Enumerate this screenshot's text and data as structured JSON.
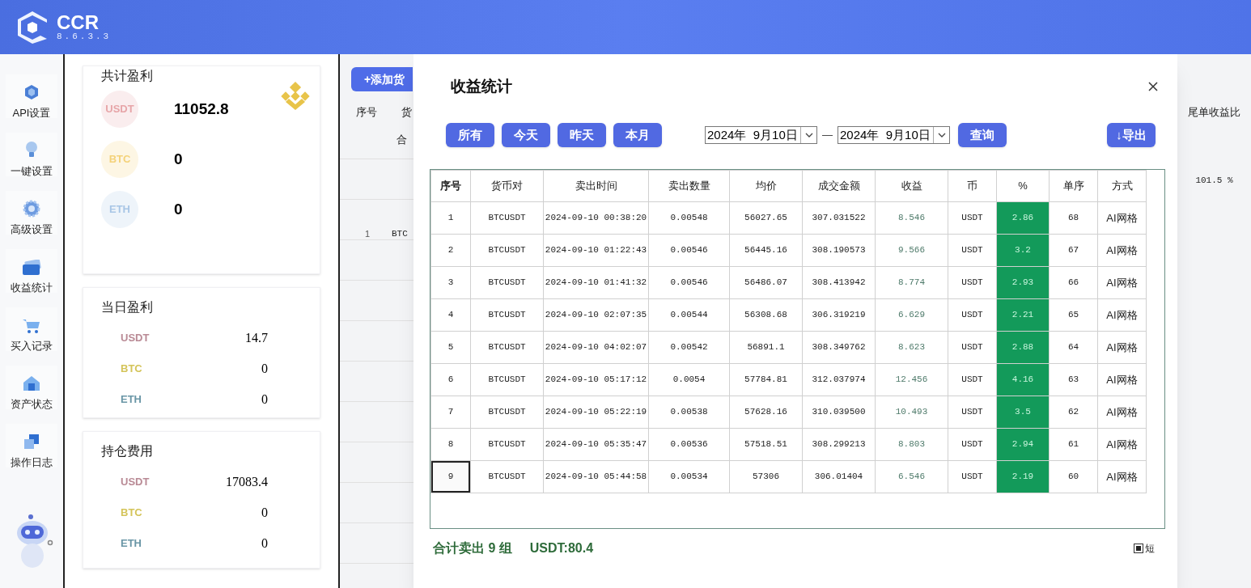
{
  "app": {
    "name": "CCR",
    "version": "8.6.3.3"
  },
  "sidebar": {
    "items": [
      {
        "label": "API设置"
      },
      {
        "label": "一键设置"
      },
      {
        "label": "高级设置"
      },
      {
        "label": "收益统计"
      },
      {
        "label": "买入记录"
      },
      {
        "label": "资产状态"
      },
      {
        "label": "操作日志"
      }
    ]
  },
  "summary": {
    "total": {
      "title": "共计盈利",
      "rows": [
        {
          "coin": "USDT",
          "value": "11052.8",
          "color": "#e7a5a8"
        },
        {
          "coin": "BTC",
          "value": "0",
          "color": "#f4d27a"
        },
        {
          "coin": "ETH",
          "value": "0",
          "color": "#a9c6e6"
        }
      ]
    },
    "today": {
      "title": "当日盈利",
      "rows": [
        {
          "coin": "USDT",
          "value": "14.7",
          "color": "#b98a95"
        },
        {
          "coin": "BTC",
          "value": "0",
          "color": "#d4c45a"
        },
        {
          "coin": "ETH",
          "value": "0",
          "color": "#6a96a6"
        }
      ]
    },
    "holding": {
      "title": "持仓费用",
      "rows": [
        {
          "coin": "USDT",
          "value": "17083.4",
          "color": "#b98a95"
        },
        {
          "coin": "BTC",
          "value": "0",
          "color": "#d4c45a"
        },
        {
          "coin": "ETH",
          "value": "0",
          "color": "#6a96a6"
        }
      ]
    }
  },
  "background_table": {
    "add_button": "+添加货",
    "columns": [
      "序号",
      "货"
    ],
    "cell_partial": "合",
    "row": [
      "1",
      "BTC"
    ],
    "right_column": "尾单收益比",
    "right_value": "101.5 %"
  },
  "dialog": {
    "title": "收益统计",
    "filters": [
      {
        "label": "所有"
      },
      {
        "label": "今天"
      },
      {
        "label": "昨天"
      },
      {
        "label": "本月"
      }
    ],
    "date_from": "2024年  9月10日",
    "date_separator": "—",
    "date_to": "2024年  9月10日",
    "query_button": "查询",
    "export_button": "↓导出",
    "columns": [
      "序号",
      "货币对",
      "卖出时间",
      "卖出数量",
      "均价",
      "成交金额",
      "收益",
      "币",
      "%",
      "单序",
      "方式"
    ],
    "rows": [
      {
        "cells": [
          "1",
          "BTCUSDT",
          "2024-09-10 00:38:20",
          "0.00548",
          "56027.65",
          "307.031522",
          "8.546",
          "USDT",
          "2.86",
          "68",
          "AI网格"
        ],
        "selected": false
      },
      {
        "cells": [
          "2",
          "BTCUSDT",
          "2024-09-10 01:22:43",
          "0.00546",
          "56445.16",
          "308.190573",
          "9.566",
          "USDT",
          "3.2",
          "67",
          "AI网格"
        ],
        "selected": false
      },
      {
        "cells": [
          "3",
          "BTCUSDT",
          "2024-09-10 01:41:32",
          "0.00546",
          "56486.07",
          "308.413942",
          "8.774",
          "USDT",
          "2.93",
          "66",
          "AI网格"
        ],
        "selected": false
      },
      {
        "cells": [
          "4",
          "BTCUSDT",
          "2024-09-10 02:07:35",
          "0.00544",
          "56308.68",
          "306.319219",
          "6.629",
          "USDT",
          "2.21",
          "65",
          "AI网格"
        ],
        "selected": false
      },
      {
        "cells": [
          "5",
          "BTCUSDT",
          "2024-09-10 04:02:07",
          "0.00542",
          "56891.1",
          "308.349762",
          "8.623",
          "USDT",
          "2.88",
          "64",
          "AI网格"
        ],
        "selected": false
      },
      {
        "cells": [
          "6",
          "BTCUSDT",
          "2024-09-10 05:17:12",
          "0.0054",
          "57784.81",
          "312.037974",
          "12.456",
          "USDT",
          "4.16",
          "63",
          "AI网格"
        ],
        "selected": false
      },
      {
        "cells": [
          "7",
          "BTCUSDT",
          "2024-09-10 05:22:19",
          "0.00538",
          "57628.16",
          "310.039500",
          "10.493",
          "USDT",
          "3.5",
          "62",
          "AI网格"
        ],
        "selected": false
      },
      {
        "cells": [
          "8",
          "BTCUSDT",
          "2024-09-10 05:35:47",
          "0.00536",
          "57518.51",
          "308.299213",
          "8.803",
          "USDT",
          "2.94",
          "61",
          "AI网格"
        ],
        "selected": false
      },
      {
        "cells": [
          "9",
          "BTCUSDT",
          "2024-09-10 05:44:58",
          "0.00534",
          "57306",
          "306.01404",
          "6.546",
          "USDT",
          "2.19",
          "60",
          "AI网格"
        ],
        "selected": true
      }
    ],
    "footer": {
      "count": "合计卖出 9 组",
      "total": "USDT:80.4"
    },
    "checkbox": {
      "label": "短",
      "checked": true
    }
  }
}
